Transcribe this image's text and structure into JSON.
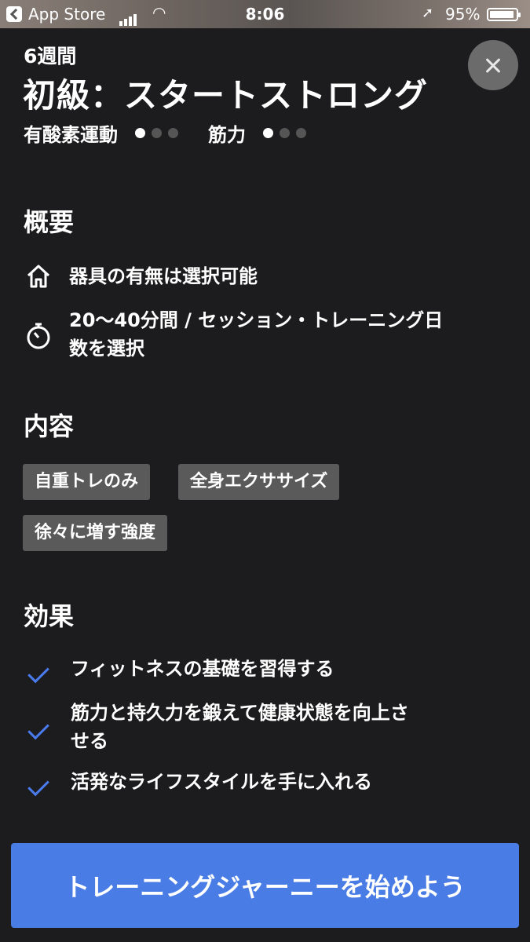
{
  "status_bar": {
    "back_app": "App Store",
    "time": "8:06",
    "battery": "95%"
  },
  "header": {
    "weeks": "6週間",
    "title": "初級：スタートストロング",
    "cardio_label": "有酸素運動",
    "cardio_level": 1,
    "strength_label": "筋力",
    "strength_level": 1,
    "level_max": 3
  },
  "overview": {
    "heading": "概要",
    "items": [
      {
        "icon": "home-icon",
        "text": "器具の有無は選択可能"
      },
      {
        "icon": "stopwatch-icon",
        "line1": "20〜40分間 / セッション・トレーニング日",
        "line2": "数を選択"
      }
    ]
  },
  "content": {
    "heading": "内容",
    "tags": [
      "自重トレのみ",
      "全身エクササイズ",
      "徐々に増す強度"
    ]
  },
  "benefits": {
    "heading": "効果",
    "items": [
      {
        "line1": "フィットネスの基礎を習得する"
      },
      {
        "line1": "筋力と持久力を鍛えて健康状態を向上さ",
        "line2": "せる"
      },
      {
        "line1": "活発なライフスタイルを手に入れる"
      }
    ]
  },
  "cta": {
    "label": "トレーニングジャーニーを始めよう"
  },
  "colors": {
    "accent": "#4a7ce6",
    "check": "#4a7cf0",
    "background": "#1c1c1e",
    "tag": "#5a5a5a"
  }
}
